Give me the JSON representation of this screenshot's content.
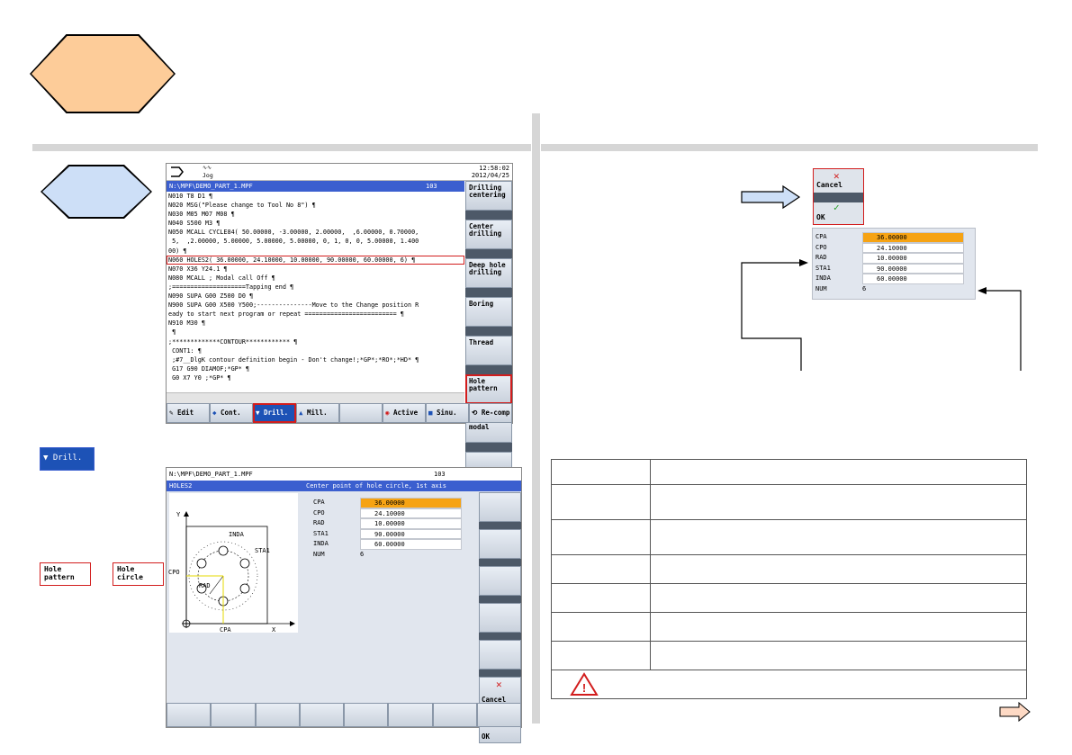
{
  "screen1": {
    "mode_label": "Jog",
    "time": "12:58:02",
    "date": "2012/04/25",
    "path": "N:\\MPF\\DEMO_PART_1.MPF",
    "line_count": "103",
    "code_lines": [
      "N010 T8 D1 ¶",
      "N020 MSG(\"Please change to Tool No 8\") ¶",
      "N030 M05 M07 M08 ¶",
      "N040 S500 M3 ¶",
      "N050 MCALL CYCLE84( 50.00000, -3.00000, 2.00000,  ,6.00000, 0.70000,",
      " 5,  ,2.00000, 5.00000, 5.00000, 5.00000, 0, 1, 0, 0, 5.00000, 1.400",
      "00) ¶",
      "N060 HOLES2( 36.00000, 24.10000, 10.00000, 90.00000, 60.00000, 6) ¶",
      "N070 X36 Y24.1 ¶",
      "N080 MCALL ; Modal call Off ¶",
      ";====================Tapping end ¶",
      "N090 SUPA G00 Z500 D0 ¶",
      "N900 SUPA G00 X500 Y500;---------------Move to the Change position R",
      "eady to start next program or repeat ========================= ¶",
      "N910 M30 ¶",
      " ¶",
      ";*************CONTOUR************ ¶",
      " CONT1: ¶",
      " ;#7__DlgK contour definition begin - Don't change!;*GP*;*RO*;*HD* ¶",
      " G17 G90 DIAMOF;*GP* ¶",
      " G0 X7 Y0 ;*GP* ¶"
    ],
    "right_softkeys": [
      "Drilling centering",
      "Center drilling",
      "Deep hole drilling",
      "Boring",
      "Thread",
      "Hole pattern",
      "Deselect modal",
      ""
    ],
    "bottom_softkeys": [
      "Edit",
      "Cont.",
      "Drill.",
      "Mill.",
      "",
      "Active",
      "Sinu.",
      "Re-comp."
    ]
  },
  "side_buttons": {
    "drill": "Drill.",
    "hole_pattern": "Hole pattern",
    "hole_circle": "Hole circle"
  },
  "screen2": {
    "path": "N:\\MPF\\DEMO_PART_1.MPF",
    "line_count": "103",
    "cycle": "HOLES2",
    "hint": "Center point of hole circle, 1st axis",
    "diagram_labels": {
      "y": "Y",
      "x": "X",
      "cpo": "CPO",
      "cpa": "CPA",
      "rad": "RAD",
      "inda": "INDA",
      "sta1": "STA1"
    },
    "params": [
      {
        "name": "CPA",
        "value": "36.00000"
      },
      {
        "name": "CPO",
        "value": "24.10000"
      },
      {
        "name": "RAD",
        "value": "10.00000"
      },
      {
        "name": "STA1",
        "value": "90.00000"
      },
      {
        "name": "INDA",
        "value": "60.00000"
      },
      {
        "name": "NUM",
        "value": "6"
      }
    ],
    "cancel": "Cancel",
    "ok": "OK"
  },
  "right": {
    "cancel": "Cancel",
    "ok": "OK",
    "params": [
      {
        "name": "CPA",
        "value": "36.00000"
      },
      {
        "name": "CPO",
        "value": "24.10000"
      },
      {
        "name": "RAD",
        "value": "10.00000"
      },
      {
        "name": "STA1",
        "value": "90.00000"
      },
      {
        "name": "INDA",
        "value": "60.00000"
      },
      {
        "name": "NUM",
        "value": "6"
      }
    ]
  },
  "colors": {
    "accent_blue": "#3b5fcf",
    "highlight_red": "#d21d1d",
    "selected_orange": "#f6a313",
    "hex_orange": "#fdcc99",
    "hex_blue": "#cddff7"
  }
}
